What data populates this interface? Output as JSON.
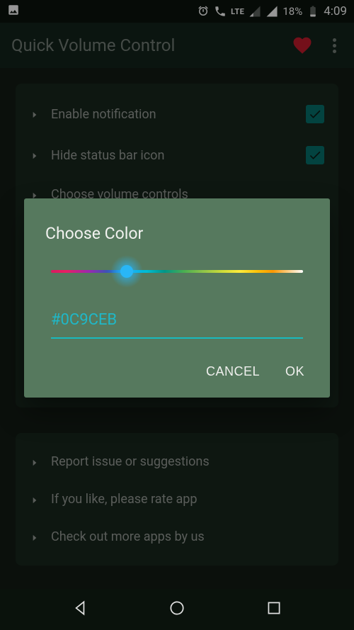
{
  "status_bar": {
    "lte": "LTE",
    "battery_pct": "18%",
    "time": "4:09"
  },
  "app_bar": {
    "title": "Quick Volume Control"
  },
  "settings_card": {
    "items": [
      {
        "label": "Enable notification",
        "checked": true
      },
      {
        "label": "Hide status bar icon",
        "checked": true
      },
      {
        "label": "Choose volume controls",
        "checked": null
      }
    ]
  },
  "info_card": {
    "items": [
      {
        "label": "Report issue or suggestions"
      },
      {
        "label": "If you like, please rate app"
      },
      {
        "label": "Check out more apps by us"
      }
    ]
  },
  "dialog": {
    "title": "Choose Color",
    "hex_value": "#0C9CEB",
    "cancel": "CANCEL",
    "ok": "OK",
    "thumb_position_pct": 30
  }
}
